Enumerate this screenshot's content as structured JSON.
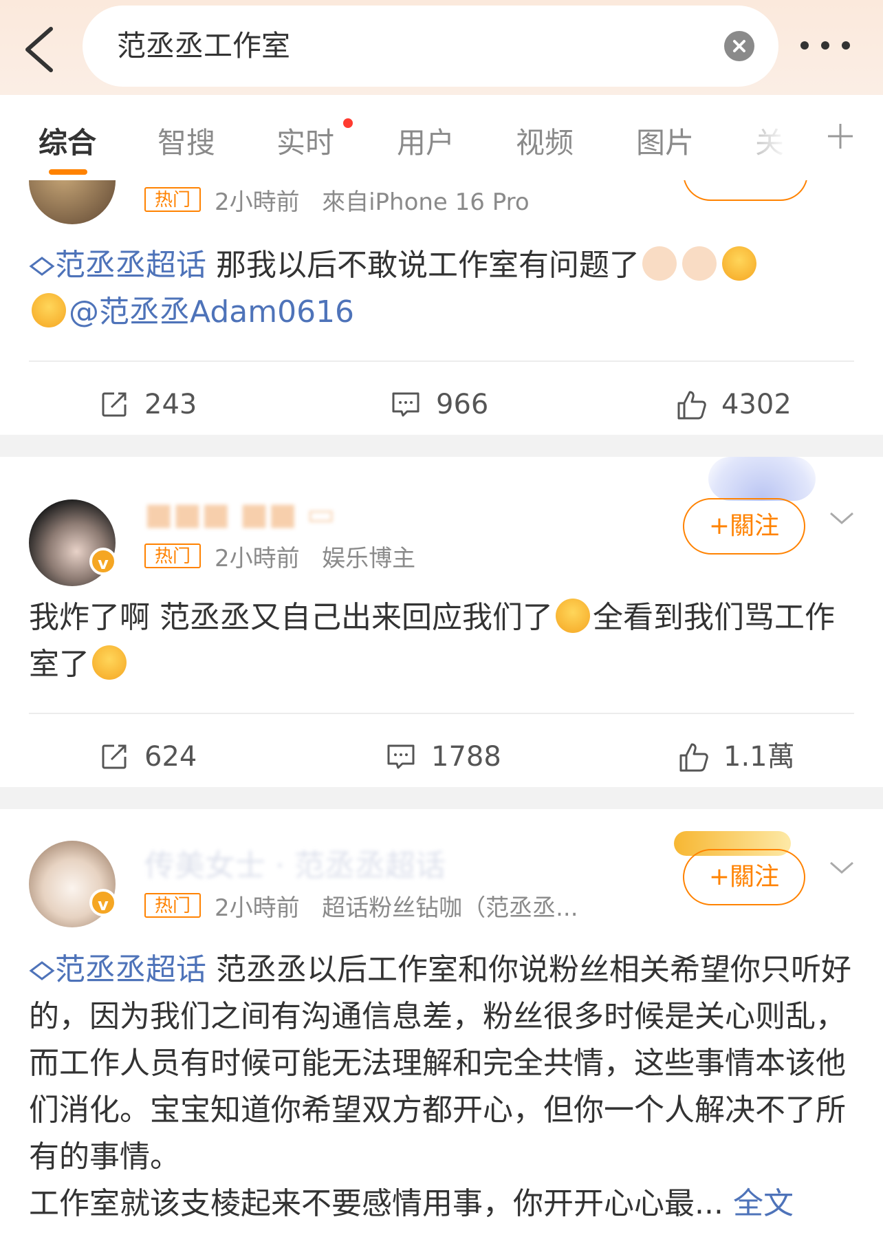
{
  "header": {
    "search_query": "范丞丞工作室",
    "back_icon": "chevron-left-icon",
    "clear_icon": "close-circle-icon",
    "more_icon": "more-horizontal-icon"
  },
  "tabs": [
    {
      "label": "综合",
      "active": true
    },
    {
      "label": "智搜"
    },
    {
      "label": "实时",
      "badge": "red-dot"
    },
    {
      "label": "用户"
    },
    {
      "label": "视频"
    },
    {
      "label": "图片"
    },
    {
      "label": "关"
    }
  ],
  "colors": {
    "accent": "#ff8200",
    "link": "#4e73b9",
    "badge": "#ff3b30"
  },
  "posts": [
    {
      "hot_tag": "热门",
      "time": "2小時前",
      "source": "來自iPhone 16 Pro",
      "topic": "范丞丞超话",
      "text": "那我以后不敢说工作室有问题了",
      "mention": "@范丞丞Adam0616",
      "emojis": [
        "pointing-right-emoji",
        "pointing-left-emoji",
        "fearful-face-emoji",
        "crying-face-emoji"
      ],
      "reposts": "243",
      "comments": "966",
      "likes": "4302"
    },
    {
      "hot_tag": "热门",
      "time": "2小時前",
      "source": "娱乐博主",
      "follow_label": "+關注",
      "text_a": "我炸了啊 范丞丞又自己出来回应我们了",
      "text_b": "全看到我们骂工作室了",
      "emojis": [
        "sobbing-face-emoji",
        "sobbing-face-emoji"
      ],
      "reposts": "624",
      "comments": "1788",
      "likes": "1.1萬"
    },
    {
      "name": "传美女士 · 范丞丞超话",
      "hot_tag": "热门",
      "time": "2小時前",
      "source": "超话粉丝钻咖（范丞丞...",
      "follow_label": "+關注",
      "topic": "范丞丞超话",
      "text": "范丞丞以后工作室和你说粉丝相关希望你只听好的，因为我们之间有沟通信息差，粉丝很多时候是关心则乱，而工作人员有时候可能无法理解和完全共情，这些事情本该他们消化。宝宝知道你希望双方都开心，但你一个人解决不了所有的事情。",
      "text_2": "工作室就该支棱起来不要感情用事，你开开心心最...",
      "more_label": "全文"
    }
  ]
}
